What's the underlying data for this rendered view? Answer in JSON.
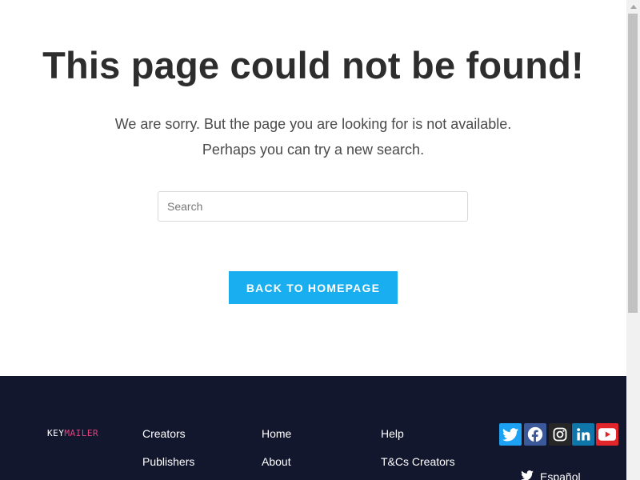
{
  "main": {
    "title": "This page could not be found!",
    "message_line1": "We are sorry. But the page you are looking for is not available.",
    "message_line2": "Perhaps you can try a new search.",
    "search": {
      "placeholder": "Search",
      "value": ""
    },
    "back_button_label": "BACK TO HOMEPAGE"
  },
  "footer": {
    "logo": {
      "part1": "KEY",
      "part2": "MAILER"
    },
    "columns": [
      {
        "links": [
          "Creators",
          "Publishers"
        ]
      },
      {
        "links": [
          "Home",
          "About"
        ]
      },
      {
        "links": [
          "Help",
          "T&Cs Creators"
        ]
      }
    ],
    "social_icons": [
      "twitter-icon",
      "facebook-icon",
      "instagram-icon",
      "linkedin-icon",
      "youtube-icon"
    ],
    "language": {
      "label": "Español",
      "icon": "twitter-icon"
    }
  },
  "colors": {
    "accent": "#18aeef",
    "footer_bg": "#13172e",
    "logo_accent": "#e83f7e",
    "twitter": "#1da1f2",
    "facebook": "#3b5998",
    "instagram": "#262626",
    "linkedin": "#0e76a8",
    "youtube": "#e0262b"
  }
}
